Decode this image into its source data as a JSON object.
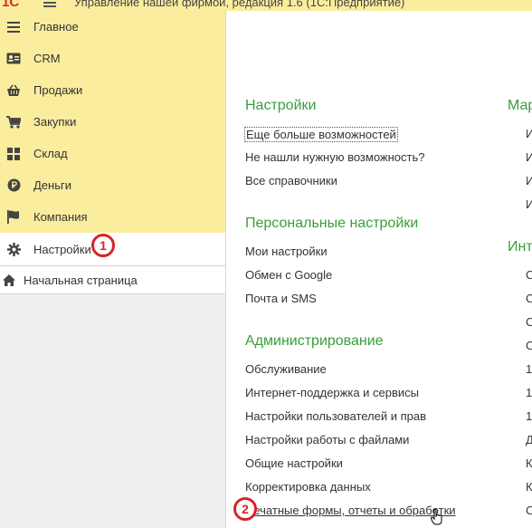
{
  "window": {
    "title": "Управление нашей фирмой, редакция 1.6 (1С:Предприятие)",
    "logo": "1С"
  },
  "sidebar": {
    "items": [
      {
        "label": "Главное",
        "icon": "menu-icon"
      },
      {
        "label": "CRM",
        "icon": "contact-card-icon"
      },
      {
        "label": "Продажи",
        "icon": "basket-icon"
      },
      {
        "label": "Закупки",
        "icon": "cart-icon"
      },
      {
        "label": "Склад",
        "icon": "warehouse-grid-icon"
      },
      {
        "label": "Деньги",
        "icon": "ruble-coin-icon"
      },
      {
        "label": "Компания",
        "icon": "flag-icon"
      }
    ],
    "active": {
      "label": "Настройки",
      "icon": "gear-icon"
    },
    "start_page": {
      "label": "Начальная страница",
      "icon": "home-icon"
    }
  },
  "badges": {
    "one": "1",
    "two": "2"
  },
  "content": {
    "sections": [
      {
        "title": "Настройки",
        "links": [
          "Еще больше возможностей",
          "Не нашли нужную возможность?",
          "Все справочники"
        ]
      },
      {
        "title": "Персональные настройки",
        "links": [
          "Мои настройки",
          "Обмен с Google",
          "Почта и SMS"
        ]
      },
      {
        "title": "Администрирование",
        "links": [
          "Обслуживание",
          "Интернет-поддержка и сервисы",
          "Настройки пользователей и прав",
          "Настройки работы с файлами",
          "Общие настройки",
          "Корректировка данных",
          "Печатные формы, отчеты и обработки"
        ]
      }
    ],
    "col2": {
      "section1_title": "Мар",
      "section1_links": [
        "И",
        "И",
        "И",
        "И"
      ],
      "section2_title": "Инт",
      "section2_links": [
        "С",
        "С",
        "С",
        "С",
        "1",
        "1",
        "1",
        "Д",
        "К",
        "К",
        "С"
      ]
    }
  },
  "colors": {
    "sidebar_yellow": "#fbed9e",
    "section_green": "#3a9d3a",
    "badge_red": "#d9232a"
  }
}
